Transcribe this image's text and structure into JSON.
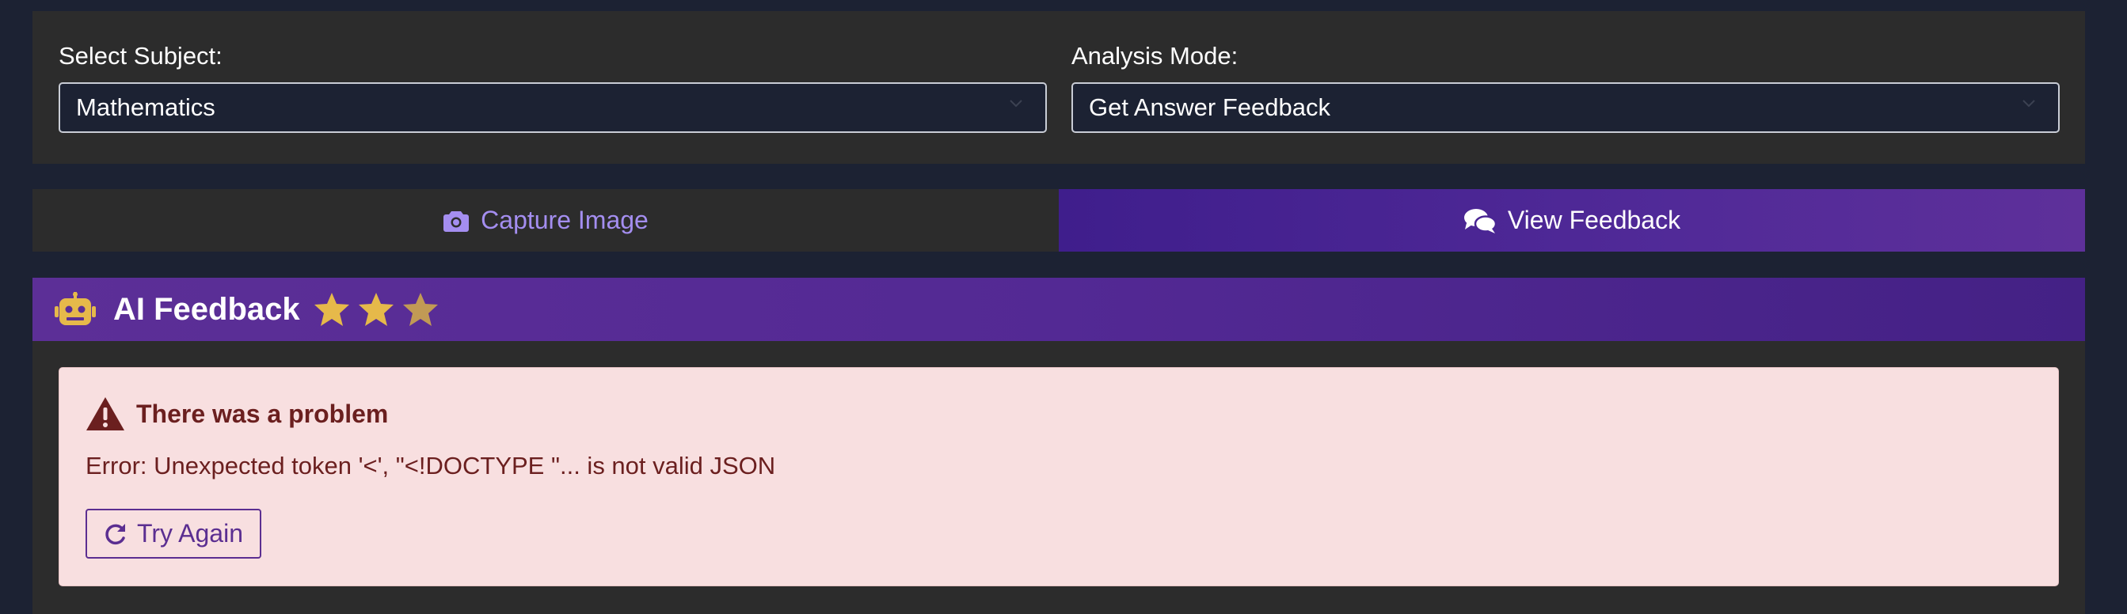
{
  "selectors": {
    "subject": {
      "label": "Select Subject:",
      "value": "Mathematics"
    },
    "mode": {
      "label": "Analysis Mode:",
      "value": "Get Answer Feedback"
    }
  },
  "tabs": {
    "capture": {
      "label": "Capture Image",
      "icon": "camera-icon"
    },
    "feedback": {
      "label": "View Feedback",
      "icon": "comments-icon",
      "active": true
    }
  },
  "feedback": {
    "title": "AI Feedback",
    "icon": "robot-icon",
    "stars": 3,
    "error": {
      "heading": "There was a problem",
      "icon": "warning-triangle-icon",
      "message": "Error: Unexpected token '<', \"<!DOCTYPE \"... is not valid JSON",
      "retry_label": "Try Again",
      "retry_icon": "redo-icon"
    }
  },
  "colors": {
    "page_bg": "#1c2233",
    "panel_bg": "#2c2c2c",
    "accent_purple": "#512a98",
    "tab_text_inactive": "#a48ef0",
    "star_gold": "#e6b94a",
    "error_bg": "#f8dfe0",
    "error_text": "#6b1f1f"
  }
}
